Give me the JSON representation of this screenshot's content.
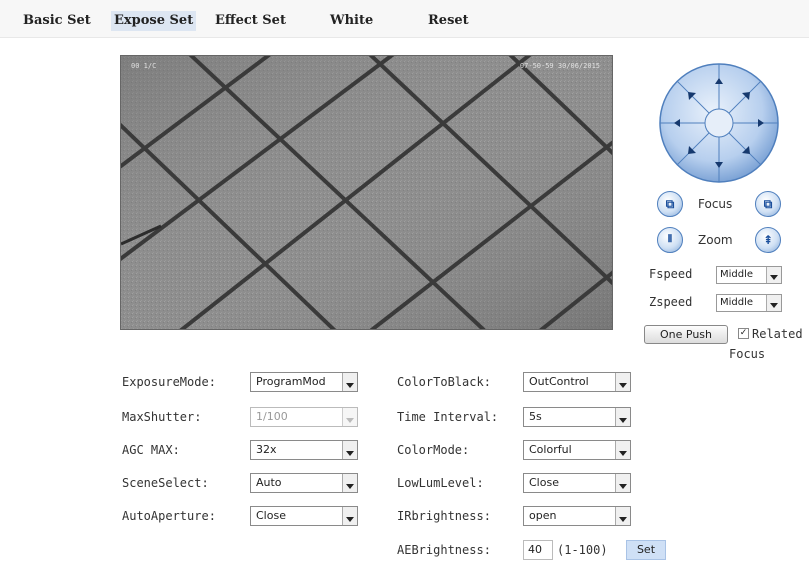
{
  "tabs": [
    {
      "label": "Basic Set"
    },
    {
      "label": "Expose Set",
      "active": true
    },
    {
      "label": "Effect Set"
    },
    {
      "label": "White"
    },
    {
      "label": "Reset"
    }
  ],
  "video": {
    "osd_left": "00 1/C",
    "osd_right": "07-50-59 30/06/2015"
  },
  "ptz": {
    "pad_icon": "ptz-direction-pad",
    "focus_label": "Focus",
    "focus_near_icon": "focus-near-icon",
    "focus_far_icon": "focus-far-icon",
    "zoom_label": "Zoom",
    "zoom_out_icon": "zoom-out-icon",
    "zoom_in_icon": "zoom-in-icon",
    "fspeed_label": "Fspeed",
    "fspeed_value": "Middle",
    "zspeed_label": "Zspeed",
    "zspeed_value": "Middle",
    "one_push_label": "One Push",
    "related_label": "Related",
    "related_checked": true,
    "focus_caption": "Focus"
  },
  "settings": {
    "left": [
      {
        "label": "ExposureMode:",
        "value": "ProgramMod",
        "disabled": false
      },
      {
        "label": "MaxShutter:",
        "value": "1/100",
        "disabled": true
      },
      {
        "label": "AGC MAX:",
        "value": "32x",
        "disabled": false
      },
      {
        "label": "SceneSelect:",
        "value": "Auto",
        "disabled": false
      },
      {
        "label": "AutoAperture:",
        "value": "Close",
        "disabled": false
      }
    ],
    "right": [
      {
        "label": "ColorToBlack:",
        "value": "OutControl"
      },
      {
        "label": "Time Interval:",
        "value": "5s"
      },
      {
        "label": "ColorMode:",
        "value": "Colorful"
      },
      {
        "label": "LowLumLevel:",
        "value": "Close"
      },
      {
        "label": "IRbrightness:",
        "value": "open"
      }
    ],
    "ae_brightness": {
      "label": "AEBrightness:",
      "value": "40",
      "range": "(1-100)",
      "button": "Set"
    }
  },
  "colors": {
    "accent": "#4f7fbd",
    "active_tab": "#dde6f2",
    "set_button": "#cfe0f6"
  }
}
